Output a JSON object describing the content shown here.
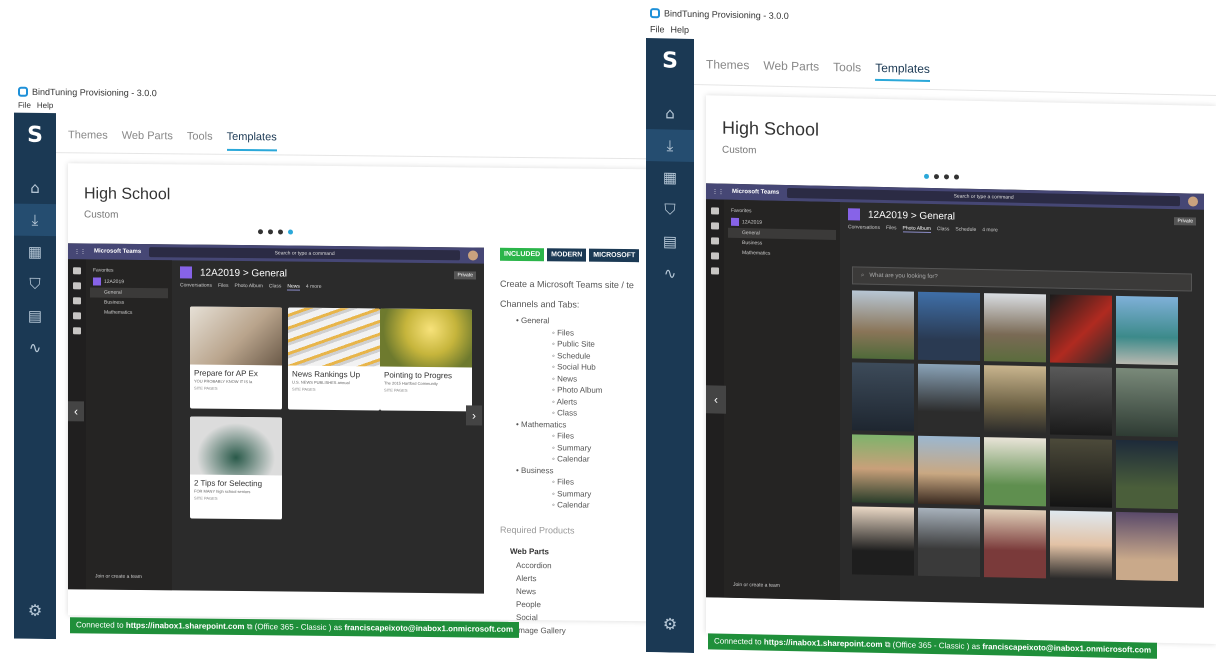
{
  "app": {
    "title": "BindTuning Provisioning - 3.0.0",
    "menu": [
      "File",
      "Help"
    ],
    "logo_letter": "S"
  },
  "tabs": [
    "Themes",
    "Web Parts",
    "Tools",
    "Templates"
  ],
  "active_tab": "Templates",
  "template": {
    "title": "High School",
    "subtitle": "Custom"
  },
  "teams": {
    "product": "Microsoft Teams",
    "search_placeholder": "Search or type a command",
    "favorites_label": "Favorites",
    "team_name": "12A2019",
    "channels": [
      "General",
      "Business",
      "Mathematics"
    ],
    "channel_title": "12A2019 > General",
    "private_badge": "Private",
    "join_label": "Join or create a team",
    "tabs_left": [
      "Conversations",
      "Files",
      "Photo Album",
      "Class",
      "News",
      "4 more"
    ],
    "tabs_right": [
      "Conversations",
      "Files",
      "Photo Album",
      "Class",
      "Schedule",
      "4 more"
    ],
    "photo_search": "What are you looking for?"
  },
  "news_cards": [
    {
      "title": "Prepare for AP Ex",
      "desc": "YOU PROBABLY KNOW IT IS la",
      "meta": "SITE PAGES"
    },
    {
      "title": "News Rankings Up",
      "desc": "U.S. NEWS PUBLISHES annual",
      "meta": "SITE PAGES"
    },
    {
      "title": "Pointing to Progres",
      "desc": "The 2015 Hartford Community",
      "meta": "SITE PAGES"
    },
    {
      "title": "2 Tips for Selecting",
      "desc": "FOR MANY high school seniors",
      "meta": "SITE PAGES"
    }
  ],
  "info": {
    "badges": [
      "INCLUDED",
      "MODERN",
      "MICROSOFT"
    ],
    "description": "Create a Microsoft Teams site / te",
    "channels_heading": "Channels and Tabs:",
    "channels": [
      {
        "name": "General",
        "tabs": [
          "Files",
          "Public Site",
          "Schedule",
          "Social Hub",
          "News",
          "Photo Album",
          "Alerts",
          "Class"
        ]
      },
      {
        "name": "Mathematics",
        "tabs": [
          "Files",
          "Summary",
          "Calendar"
        ]
      },
      {
        "name": "Business",
        "tabs": [
          "Files",
          "Summary",
          "Calendar"
        ]
      }
    ],
    "required_heading": "Required Products",
    "webparts_heading": "Web Parts",
    "webparts": [
      "Accordion",
      "Alerts",
      "News",
      "People",
      "Social",
      "Image Gallery"
    ]
  },
  "status": {
    "prefix": "Connected to ",
    "site": "https://inabox1.sharepoint.com",
    "middle": " (Office 365 - Classic ) as ",
    "user": "franciscapeixoto@inabox1.onmicrosoft.com"
  },
  "colors": {
    "nav_bg": "#1b3954",
    "accent": "#2ba8d9",
    "teams_purple": "#464775",
    "status_green": "#1f8f3a"
  },
  "icons": [
    "home-icon",
    "download-icon",
    "grid-icon",
    "cart-icon",
    "document-icon",
    "pulse-icon",
    "gear-icon"
  ]
}
